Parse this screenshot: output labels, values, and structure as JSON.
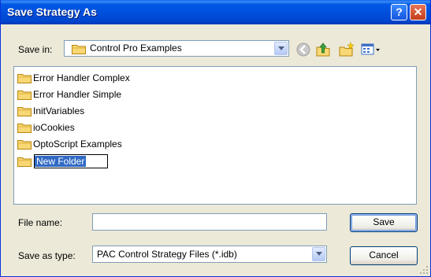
{
  "window": {
    "title": "Save Strategy As"
  },
  "title_buttons": {
    "help": "?",
    "close": "✕"
  },
  "save_in": {
    "label": "Save in:",
    "value": "Control Pro Examples"
  },
  "files": [
    {
      "name": "Error Handler Complex"
    },
    {
      "name": "Error Handler Simple"
    },
    {
      "name": "InitVariables"
    },
    {
      "name": "ioCookies"
    },
    {
      "name": "OptoScript Examples"
    },
    {
      "name": "New Folder",
      "editing": true
    }
  ],
  "file_name": {
    "label": "File name:",
    "value": ""
  },
  "save_as_type": {
    "label": "Save as type:",
    "value": "PAC Control Strategy Files (*.idb)"
  },
  "buttons": {
    "save": "Save",
    "cancel": "Cancel"
  },
  "colors": {
    "title_bar": "#0054E3",
    "selection": "#316AC5",
    "folder": "#F2C94C"
  }
}
